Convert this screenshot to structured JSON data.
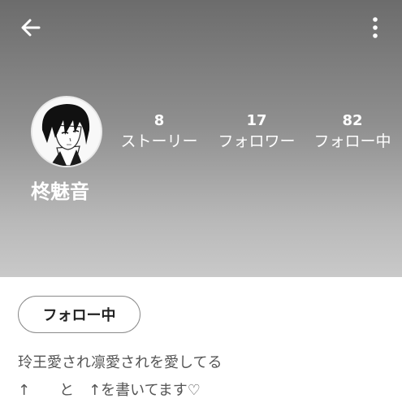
{
  "profile": {
    "username": "柊魅音",
    "stats": [
      {
        "count": "8",
        "label": "ストーリー"
      },
      {
        "count": "17",
        "label": "フォロワー"
      },
      {
        "count": "82",
        "label": "フォロー中"
      }
    ],
    "follow_button_label": "フォロー中",
    "bio": [
      "玲王愛され凛愛されを愛してる",
      "↑　　と　↑を書いてます♡"
    ]
  },
  "icons": {
    "back": "arrow-left-icon",
    "more": "more-vertical-icon"
  },
  "colors": {
    "header_top": "#6c6c6c",
    "header_bottom": "#c9c9c9",
    "text_light": "#ffffff",
    "bio_text": "#555555"
  }
}
